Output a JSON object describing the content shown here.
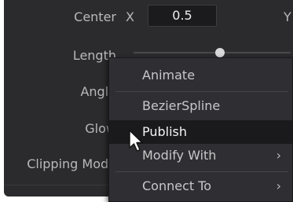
{
  "params": {
    "center_label": "Center",
    "x_label": "X",
    "x_value": "0.5",
    "y_label": "Y",
    "length_label": "Length",
    "angle_label": "Angle",
    "glow_label": "Glow",
    "clipping_label": "Clipping Mode"
  },
  "context_menu": {
    "items": [
      {
        "label": "Animate"
      },
      {
        "label": "BezierSpline"
      },
      {
        "label": "Publish"
      },
      {
        "label": "Modify With",
        "chevron": "›"
      },
      {
        "label": "Connect To",
        "chevron": "›"
      }
    ]
  },
  "icons": {
    "cursor": "arrow-cursor-icon",
    "submenu": "chevron-right-icon"
  },
  "colors": {
    "panel_bg": "#2b2b2e",
    "menu_bg": "#2f2f33",
    "highlight_bg": "#1a1a1c",
    "text": "#b9b9bc"
  }
}
